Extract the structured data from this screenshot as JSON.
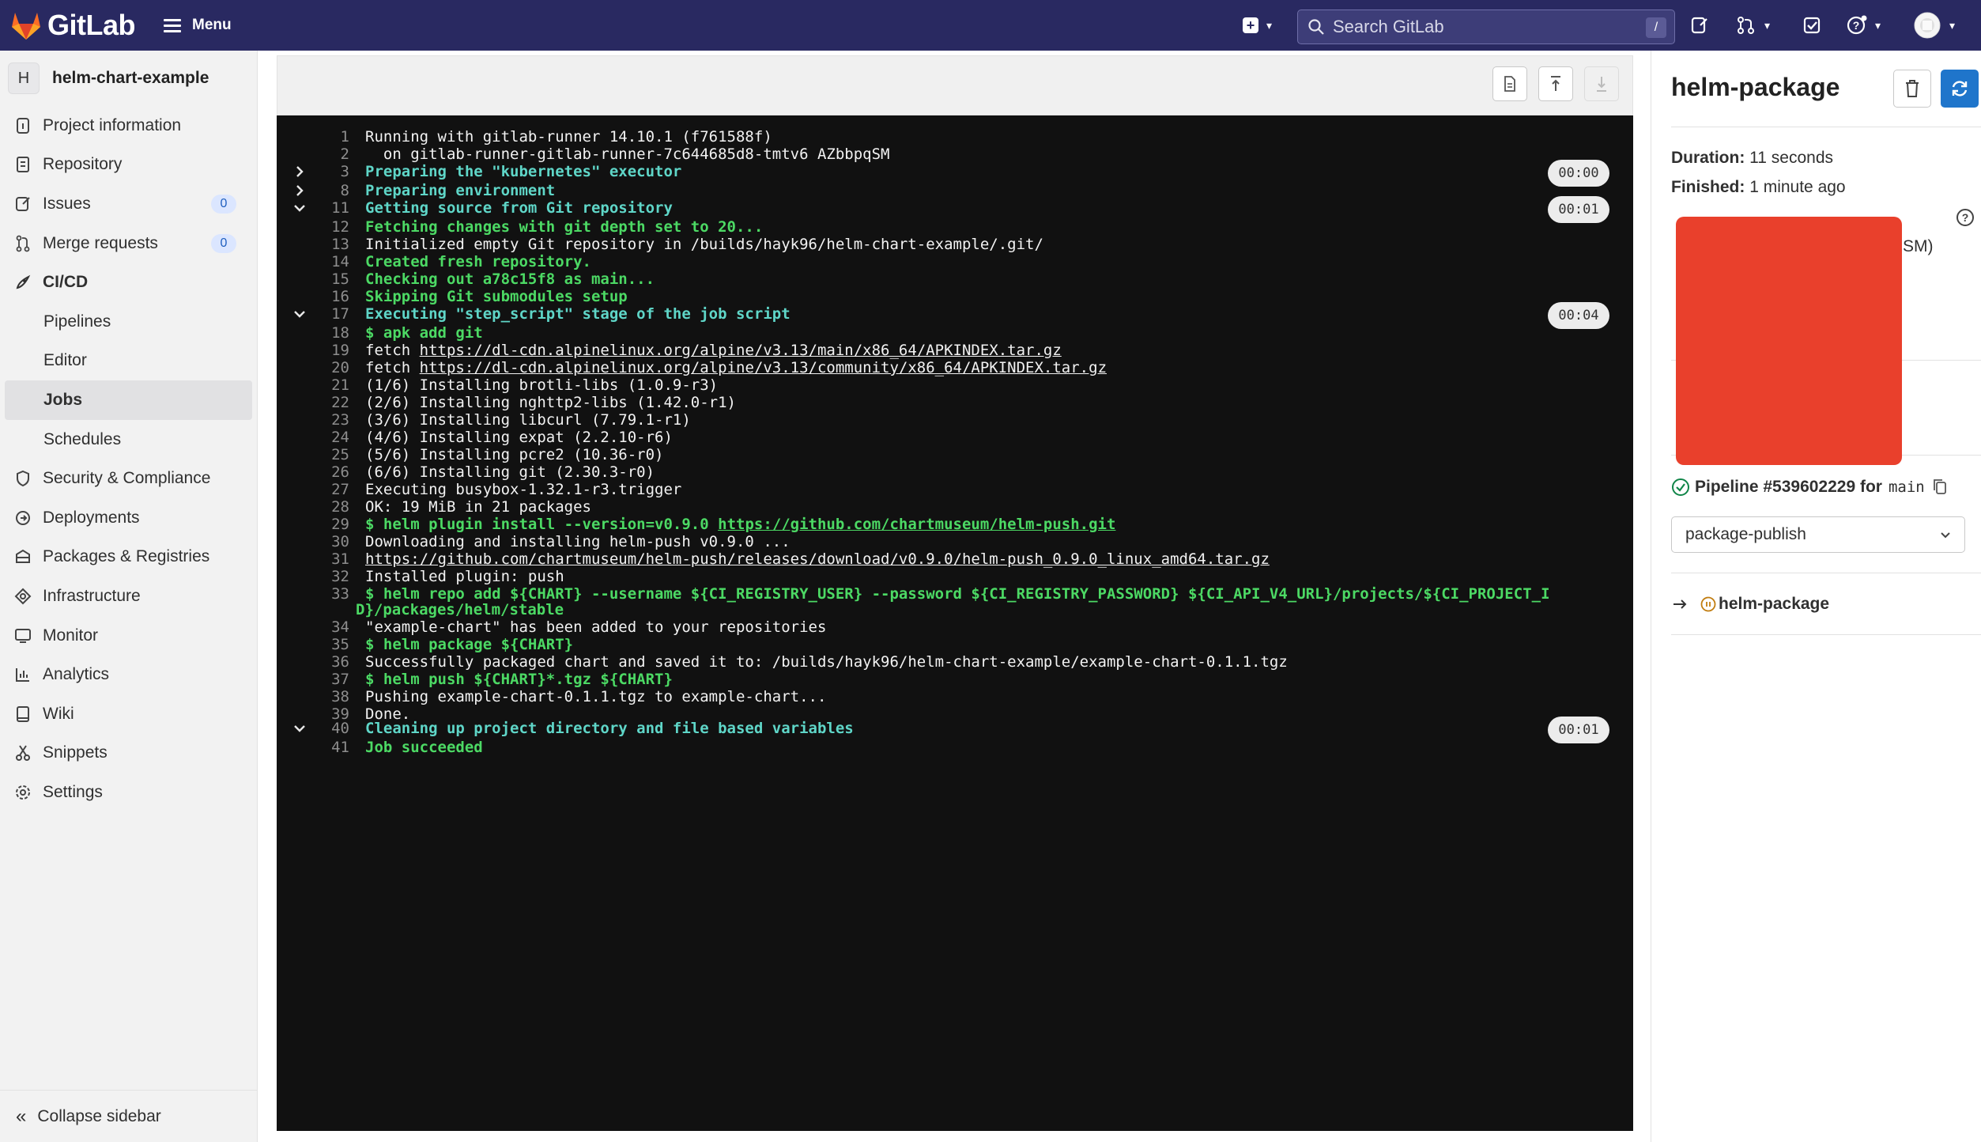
{
  "topbar": {
    "brand": "GitLab",
    "menu_label": "Menu",
    "search_placeholder": "Search GitLab",
    "search_shortcut": "/",
    "colors": {
      "bar": "#292961",
      "accent": "#fc6d26"
    }
  },
  "sidebar": {
    "project_initial": "H",
    "project_name": "helm-chart-example",
    "items": [
      {
        "label": "Project information",
        "icon": "info-icon"
      },
      {
        "label": "Repository",
        "icon": "doc-icon"
      },
      {
        "label": "Issues",
        "icon": "issues-icon",
        "badge": "0"
      },
      {
        "label": "Merge requests",
        "icon": "merge-request-icon",
        "badge": "0"
      },
      {
        "label": "CI/CD",
        "icon": "rocket-icon"
      }
    ],
    "cicd_sub": [
      "Pipelines",
      "Editor",
      "Jobs",
      "Schedules"
    ],
    "items2": [
      {
        "label": "Security & Compliance",
        "icon": "shield-icon"
      },
      {
        "label": "Deployments",
        "icon": "deployments-icon"
      },
      {
        "label": "Packages & Registries",
        "icon": "package-icon"
      },
      {
        "label": "Infrastructure",
        "icon": "infrastructure-icon"
      },
      {
        "label": "Monitor",
        "icon": "monitor-icon"
      },
      {
        "label": "Analytics",
        "icon": "chart-icon"
      },
      {
        "label": "Wiki",
        "icon": "book-icon"
      },
      {
        "label": "Snippets",
        "icon": "scissors-icon"
      },
      {
        "label": "Settings",
        "icon": "gear-icon"
      }
    ],
    "collapse_label": "Collapse sidebar"
  },
  "log": {
    "lines": [
      {
        "n": "1",
        "t": "Running with gitlab-runner 14.10.1 (f761588f)"
      },
      {
        "n": "2",
        "t": "  on gitlab-runner-gitlab-runner-7c644685d8-tmtv6 AZbbpqSM"
      },
      {
        "n": "3",
        "t": "Preparing the \"kubernetes\" executor",
        "s": "c",
        "chev": "right",
        "time": "00:00"
      },
      {
        "n": "8",
        "t": "Preparing environment",
        "s": "c",
        "chev": "right"
      },
      {
        "n": "11",
        "t": "Getting source from Git repository",
        "s": "c",
        "chev": "down",
        "time": "00:01"
      },
      {
        "n": "12",
        "t": "Fetching changes with git depth set to 20...",
        "s": "g"
      },
      {
        "n": "13",
        "t": "Initialized empty Git repository in /builds/hayk96/helm-chart-example/.git/"
      },
      {
        "n": "14",
        "t": "Created fresh repository.",
        "s": "g"
      },
      {
        "n": "15",
        "t": "Checking out a78c15f8 as main...",
        "s": "g"
      },
      {
        "n": "16",
        "t": "Skipping Git submodules setup",
        "s": "g"
      },
      {
        "n": "17",
        "t": "Executing \"step_script\" stage of the job script",
        "s": "c",
        "chev": "down",
        "time": "00:04"
      },
      {
        "n": "18",
        "t": "$ apk add git",
        "s": "g"
      },
      {
        "n": "19",
        "t": "fetch ",
        "link": "https://dl-cdn.alpinelinux.org/alpine/v3.13/main/x86_64/APKINDEX.tar.gz"
      },
      {
        "n": "20",
        "t": "fetch ",
        "link": "https://dl-cdn.alpinelinux.org/alpine/v3.13/community/x86_64/APKINDEX.tar.gz"
      },
      {
        "n": "21",
        "t": "(1/6) Installing brotli-libs (1.0.9-r3)"
      },
      {
        "n": "22",
        "t": "(2/6) Installing nghttp2-libs (1.42.0-r1)"
      },
      {
        "n": "23",
        "t": "(3/6) Installing libcurl (7.79.1-r1)"
      },
      {
        "n": "24",
        "t": "(4/6) Installing expat (2.2.10-r6)"
      },
      {
        "n": "25",
        "t": "(5/6) Installing pcre2 (10.36-r0)"
      },
      {
        "n": "26",
        "t": "(6/6) Installing git (2.30.3-r0)"
      },
      {
        "n": "27",
        "t": "Executing busybox-1.32.1-r3.trigger"
      },
      {
        "n": "28",
        "t": "OK: 19 MiB in 21 packages"
      },
      {
        "n": "29",
        "t": "$ helm plugin install --version=v0.9.0 ",
        "s": "g",
        "link": "https://github.com/chartmuseum/helm-push.git",
        "ls": "g"
      },
      {
        "n": "30",
        "t": "Downloading and installing helm-push v0.9.0 ..."
      },
      {
        "n": "31",
        "t": "",
        "link": "https://github.com/chartmuseum/helm-push/releases/download/v0.9.0/helm-push_0.9.0_linux_amd64.tar.gz"
      },
      {
        "n": "32",
        "t": "Installed plugin: push"
      },
      {
        "n": "33",
        "t": "$ helm repo add ${CHART} --username ${CI_REGISTRY_USER} --password ${CI_REGISTRY_PASSWORD} ${CI_API_V4_URL}/projects/${CI_PROJECT_I",
        "s": "g"
      },
      {
        "n": "",
        "t": "D}/packages/helm/stable",
        "s": "g",
        "wrap": true
      },
      {
        "n": "34",
        "t": "\"example-chart\" has been added to your repositories"
      },
      {
        "n": "35",
        "t": "$ helm package ${CHART}",
        "s": "g"
      },
      {
        "n": "36",
        "t": "Successfully packaged chart and saved it to: /builds/hayk96/helm-chart-example/example-chart-0.1.1.tgz"
      },
      {
        "n": "37",
        "t": "$ helm push ${CHART}*.tgz ${CHART}",
        "s": "g"
      },
      {
        "n": "38",
        "t": "Pushing example-chart-0.1.1.tgz to example-chart..."
      },
      {
        "n": "39",
        "t": "Done."
      },
      {
        "n": "40",
        "t": "Cleaning up project directory and file based variables",
        "s": "c",
        "chev": "down",
        "time": "00:01"
      },
      {
        "n": "41",
        "t": "Job succeeded",
        "s": "g"
      }
    ]
  },
  "panel": {
    "title": "helm-package",
    "duration_label": "Duration:",
    "duration_value": "11 seconds",
    "finished_label": "Finished:",
    "finished_value": "1 minute ago",
    "runner_tail": "SM)",
    "pipeline_label": "Pipeline #539602229 for",
    "pipeline_ref": "main",
    "stage_select": "package-publish",
    "job_name": "helm-package",
    "colors": {
      "retry": "#1f75cb",
      "success": "#108548",
      "manual": "#c17d10",
      "redaction": "#e9402c"
    }
  }
}
